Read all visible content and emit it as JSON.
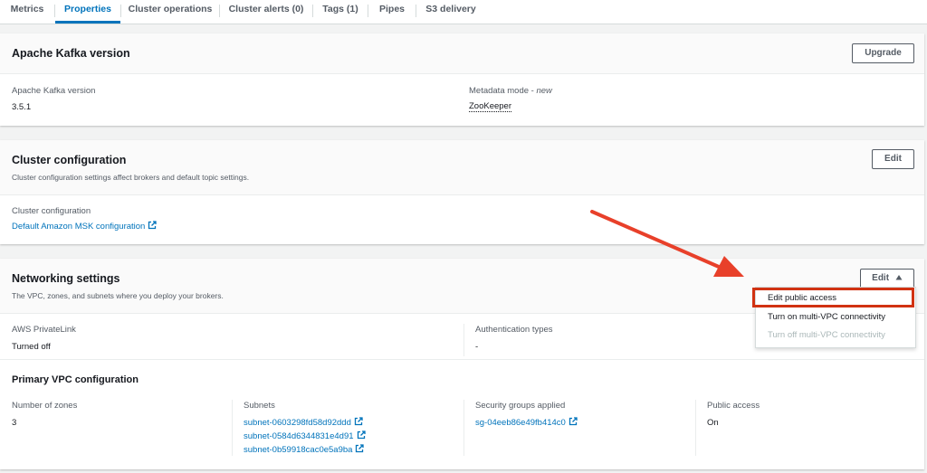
{
  "tabs": [
    {
      "label": "Metrics"
    },
    {
      "label": "Properties"
    },
    {
      "label": "Cluster operations"
    },
    {
      "label": "Cluster alerts (0)"
    },
    {
      "label": "Tags (1)"
    },
    {
      "label": "Pipes"
    },
    {
      "label": "S3 delivery"
    }
  ],
  "kafka": {
    "title": "Apache Kafka version",
    "upgrade_label": "Upgrade",
    "version_label": "Apache Kafka version",
    "version_value": "3.5.1",
    "metadata_label": "Metadata mode",
    "metadata_suffix": "new",
    "metadata_value": "ZooKeeper"
  },
  "cluster_config": {
    "title": "Cluster configuration",
    "description": "Cluster configuration settings affect brokers and default topic settings.",
    "edit_label": "Edit",
    "field_label": "Cluster configuration",
    "field_link": "Default Amazon MSK configuration"
  },
  "networking": {
    "title": "Networking settings",
    "description": "The VPC, zones, and subnets where you deploy your brokers.",
    "edit_label": "Edit",
    "privatelink_label": "AWS PrivateLink",
    "privatelink_value": "Turned off",
    "auth_label": "Authentication types",
    "auth_value": "-",
    "primary_vpc_title": "Primary VPC configuration",
    "zones_label": "Number of zones",
    "zones_value": "3",
    "subnets_label": "Subnets",
    "subnets": [
      "subnet-0603298fd58d92ddd",
      "subnet-0584d6344831e4d91",
      "subnet-0b59918cac0e5a9ba"
    ],
    "sg_label": "Security groups applied",
    "sg_value": "sg-04eeb86e49fb414c0",
    "public_access_label": "Public access",
    "public_access_value": "On"
  },
  "edit_menu": {
    "items": [
      "Edit public access",
      "Turn on multi-VPC connectivity",
      "Turn off multi-VPC connectivity"
    ],
    "highlight_color": "#d13212"
  },
  "colors": {
    "link": "#0073bb",
    "annotation": "#e8402a"
  },
  "icons": [
    "external-link-icon",
    "caret-up-icon",
    "annotation-arrow"
  ]
}
